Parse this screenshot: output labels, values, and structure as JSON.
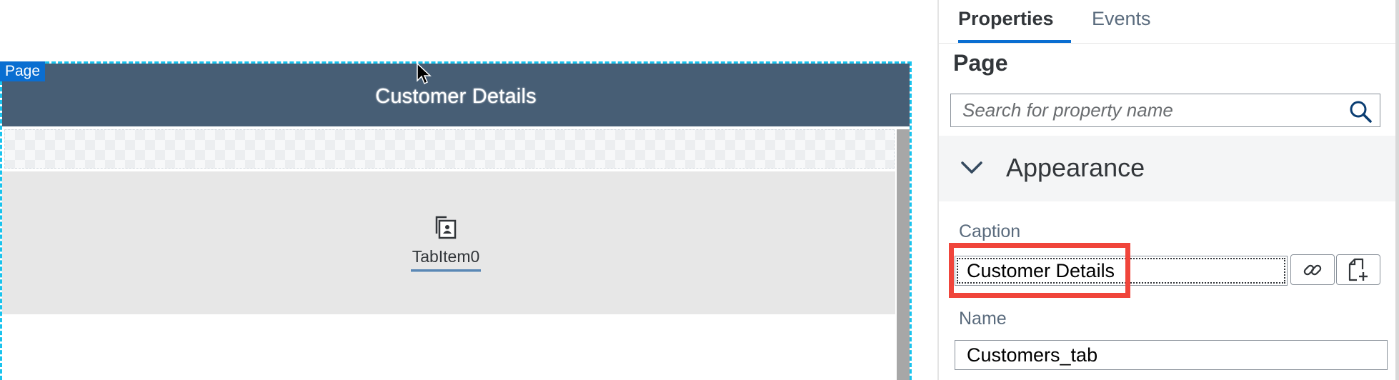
{
  "canvas": {
    "page_badge": "Page",
    "page_title": "Customer Details",
    "tab_item": {
      "label": "TabItem0",
      "icon": "tab-item-icon"
    }
  },
  "panel": {
    "tabs": [
      {
        "label": "Properties",
        "active": true
      },
      {
        "label": "Events",
        "active": false
      }
    ],
    "section_title": "Page",
    "search": {
      "placeholder": "Search for property name",
      "icon": "search-icon"
    },
    "group": {
      "title": "Appearance",
      "expanded": true,
      "icon": "chevron-down-icon"
    },
    "caption": {
      "label": "Caption",
      "value": "Customer Details",
      "bind_icon": "link-icon",
      "new_icon": "new-file-icon"
    },
    "name": {
      "label": "Name",
      "value": "Customers_tab"
    }
  },
  "colors": {
    "header_bg": "#475e75",
    "selection_dashed": "#18c3ee",
    "accent": "#0a6ed1",
    "highlight": "#f0453b"
  }
}
